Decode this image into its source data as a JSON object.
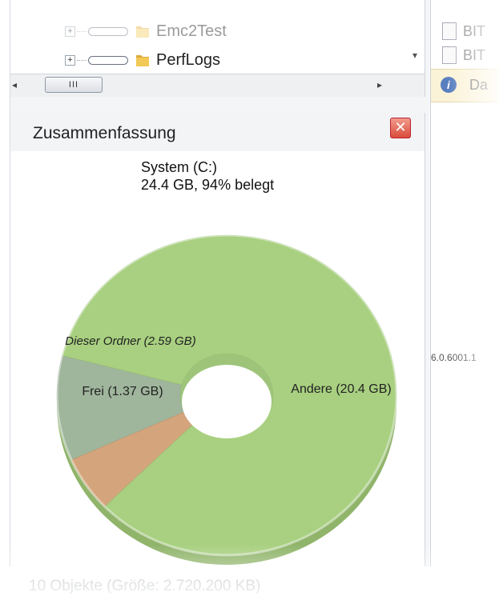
{
  "tree": {
    "items": [
      {
        "label": "Emc2Test",
        "faded": true
      },
      {
        "label": "PerfLogs",
        "faded": false
      }
    ],
    "hscroll_thumb": "III"
  },
  "summary": {
    "title": "Zusammenfassung",
    "drive_name": "System (C:)",
    "drive_usage": "24.4 GB, 94% belegt"
  },
  "chart_data": {
    "type": "pie",
    "donut": true,
    "unit": "GB",
    "slices": [
      {
        "label": "Dieser Ordner (2.59 GB)",
        "value": 2.59,
        "color": "#9fb69c"
      },
      {
        "label": "Frei (1.37 GB)",
        "value": 1.37,
        "color": "#d4a57c"
      },
      {
        "label": "Andere (20.4 GB)",
        "value": 20.4,
        "color": "#a8d080"
      }
    ]
  },
  "right_pane": {
    "doc_items": [
      "BIT",
      "BIT"
    ],
    "info_text": "Da",
    "version_text": "6.0.6001.1"
  },
  "status": {
    "text": "10 Objekte (Größe: 2.720.200 KB)"
  },
  "colors": {
    "close_button": "#d94c3a",
    "info_bar": "#fbf3d8"
  }
}
